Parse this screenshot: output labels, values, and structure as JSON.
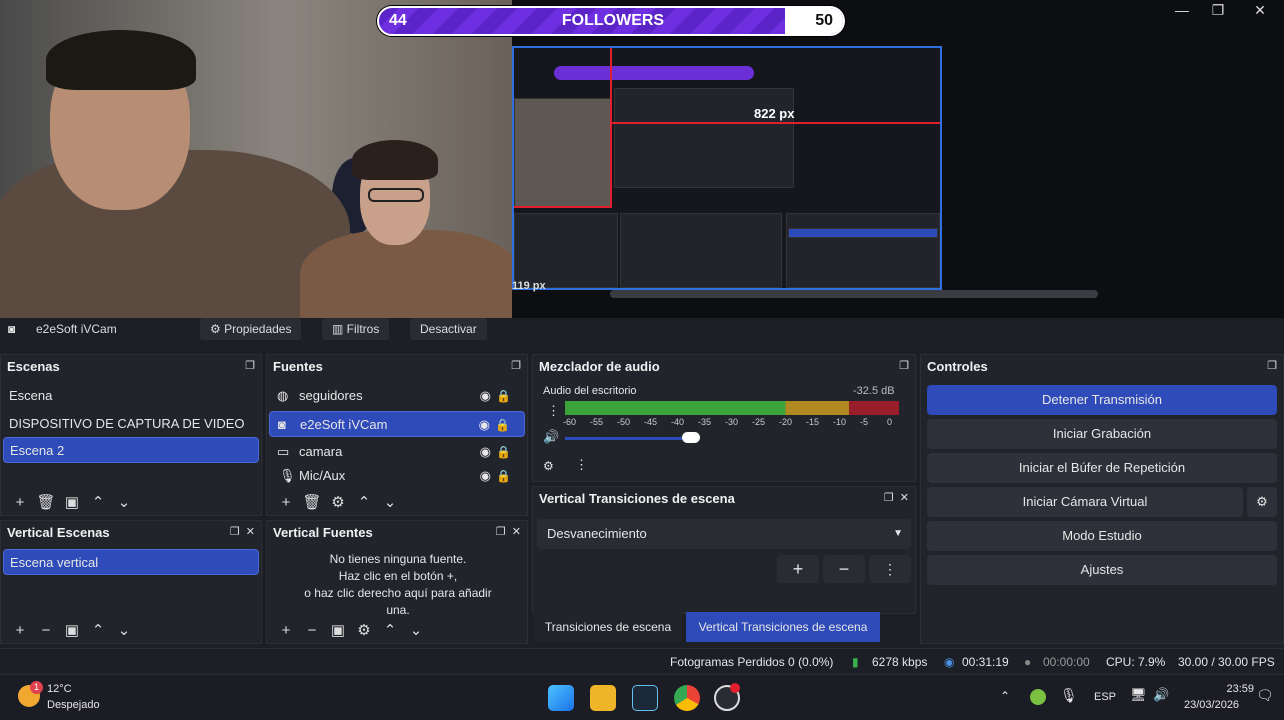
{
  "followers": {
    "current": "44",
    "title": "FOLLOWERS",
    "goal": "50"
  },
  "window": {
    "minimize": "—",
    "maximize": "❐",
    "close": "✕"
  },
  "preview": {
    "px_label": "822 px",
    "px_label2": "119 px"
  },
  "source_toolbar": {
    "source_name": "e2eSoft iVCam",
    "properties": "Propiedades",
    "filters": "Filtros",
    "deactivate": "Desactivar"
  },
  "scenes": {
    "title": "Escenas",
    "items": [
      {
        "label": "Escena",
        "selected": false
      },
      {
        "label": "DISPOSITIVO DE CAPTURA DE VIDEO",
        "selected": false
      },
      {
        "label": "Escena 2",
        "selected": true
      }
    ]
  },
  "sources": {
    "title": "Fuentes",
    "items": [
      {
        "label": "seguidores",
        "icon": "globe-icon",
        "selected": false
      },
      {
        "label": "e2eSoft iVCam",
        "icon": "camera-icon",
        "selected": true
      },
      {
        "label": "camara",
        "icon": "monitor-icon",
        "selected": false
      },
      {
        "label": "Mic/Aux",
        "icon": "mic-icon",
        "selected": false
      }
    ]
  },
  "mixer": {
    "title": "Mezclador de audio",
    "channel": "Audio del escritorio",
    "db": "-32.5 dB",
    "ticks": [
      "-60",
      "-55",
      "-50",
      "-45",
      "-40",
      "-35",
      "-30",
      "-25",
      "-20",
      "-15",
      "-10",
      "-5",
      "0"
    ],
    "volume_level": 0.78
  },
  "vertical_transitions": {
    "title": "Vertical Transiciones de escena",
    "selected": "Desvanecimiento",
    "tab1": "Transiciones de escena",
    "tab2": "Vertical Transiciones de escena"
  },
  "controls": {
    "title": "Controles",
    "buttons": [
      "Detener Transmisión",
      "Iniciar Grabación",
      "Iniciar el Búfer de Repetición",
      "Iniciar Cámara Virtual",
      "Modo Estudio",
      "Ajustes"
    ]
  },
  "vertical_scenes": {
    "title": "Vertical Escenas",
    "item": "Escena vertical"
  },
  "vertical_sources": {
    "title": "Vertical Fuentes",
    "empty_line1": "No tienes ninguna fuente.",
    "empty_line2": "Haz clic en el botón +,",
    "empty_line3": "o haz clic derecho aquí para añadir",
    "empty_line4": "una."
  },
  "status": {
    "dropped": "Fotogramas Perdidos 0 (0.0%)",
    "bitrate": "6278 kbps",
    "stream_time": "00:31:19",
    "rec_time": "00:00:00",
    "cpu": "CPU: 7.9%",
    "fps": "30.00 / 30.00 FPS"
  },
  "taskbar": {
    "weather_temp": "12°C",
    "weather_desc": "Despejado",
    "weather_badge": "1",
    "lang": "ESP",
    "time": "23:59",
    "date": "23/03/2026"
  }
}
